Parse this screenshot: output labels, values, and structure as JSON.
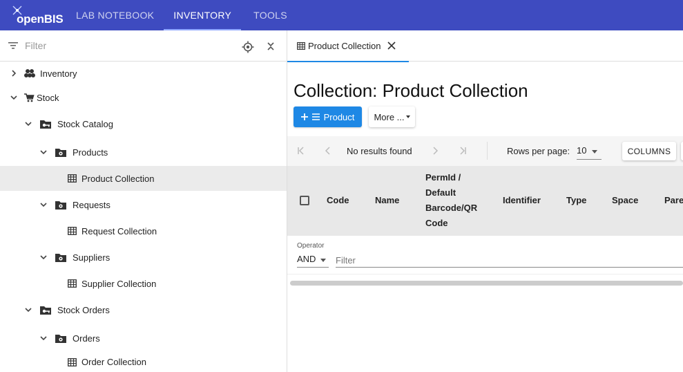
{
  "app": {
    "logo_text": "openBIS"
  },
  "nav": {
    "tabs": [
      {
        "label": "LAB NOTEBOOK"
      },
      {
        "label": "INVENTORY"
      },
      {
        "label": "TOOLS"
      }
    ],
    "active": "INVENTORY"
  },
  "sidebar": {
    "filter_placeholder": "Filter",
    "tree": [
      {
        "label": "Inventory",
        "icon": "inventory-icon",
        "expanded": false
      },
      {
        "label": "Stock",
        "icon": "cart-icon",
        "expanded": true
      },
      {
        "label": "Stock Catalog",
        "icon": "folder-key-icon",
        "expanded": true
      },
      {
        "label": "Products",
        "icon": "folder-settings-icon",
        "expanded": true
      },
      {
        "label": "Product Collection",
        "icon": "table-icon",
        "selected": true
      },
      {
        "label": "Requests",
        "icon": "folder-settings-icon",
        "expanded": true
      },
      {
        "label": "Request Collection",
        "icon": "table-icon"
      },
      {
        "label": "Suppliers",
        "icon": "folder-settings-icon",
        "expanded": true
      },
      {
        "label": "Supplier Collection",
        "icon": "table-icon"
      },
      {
        "label": "Stock Orders",
        "icon": "folder-key-icon",
        "expanded": true
      },
      {
        "label": "Orders",
        "icon": "folder-settings-icon",
        "expanded": true
      },
      {
        "label": "Order Collection",
        "icon": "table-icon"
      }
    ]
  },
  "main": {
    "open_tab": {
      "label": "Product Collection"
    },
    "title": "Collection: Product Collection",
    "add_button": "Product",
    "more_button": "More ...",
    "pager": {
      "status": "No results found",
      "rows_per_page_label": "Rows per page:",
      "rows_per_page_value": "10",
      "columns_button": "COLUMNS"
    },
    "table": {
      "columns": [
        "Code",
        "Name",
        "PermId / Default Barcode/QR Code",
        "Identifier",
        "Type",
        "Space",
        "Pare"
      ],
      "permid_lines": [
        "PermId /",
        "Default",
        "Barcode/QR",
        "Code"
      ]
    },
    "filter": {
      "operator_label": "Operator",
      "operator_value": "AND",
      "filter_placeholder": "Filter"
    }
  },
  "colors": {
    "header": "#3e4bc0",
    "primary": "#1e88e5"
  }
}
